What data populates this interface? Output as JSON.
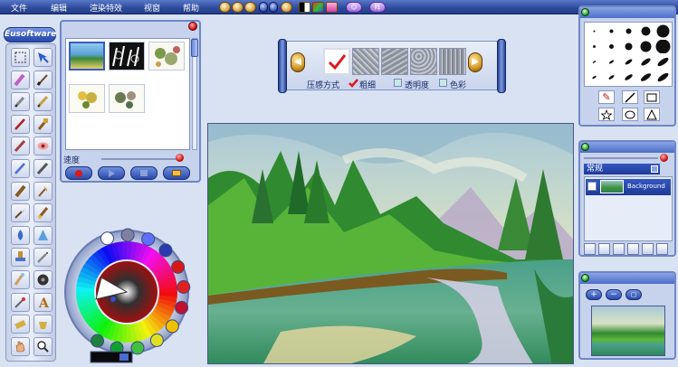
{
  "menu": {
    "items": [
      "文件",
      "编辑",
      "渲染特效",
      "视窗",
      "帮助"
    ],
    "pill_label": "阵"
  },
  "brand": {
    "name": "Eusoftware"
  },
  "tools": [
    {
      "name": "rect-select-tool",
      "icon": "dashed-rect-icon"
    },
    {
      "name": "move-tool",
      "icon": "move-arrow-icon"
    },
    {
      "name": "crayon-tool",
      "icon": "crayon-icon"
    },
    {
      "name": "brush-tool",
      "icon": "fine-brush-icon"
    },
    {
      "name": "pen-tool",
      "icon": "pen-icon"
    },
    {
      "name": "pencil-tool",
      "icon": "pencil-icon"
    },
    {
      "name": "oil-brush-tool",
      "icon": "oil-brush-icon"
    },
    {
      "name": "flat-brush-tool",
      "icon": "flat-brush-icon"
    },
    {
      "name": "marker-tool",
      "icon": "marker-icon"
    },
    {
      "name": "eye-tool",
      "icon": "eye-icon"
    },
    {
      "name": "airbrush-tool",
      "icon": "airbrush-icon"
    },
    {
      "name": "charcoal-tool",
      "icon": "charcoal-icon"
    },
    {
      "name": "wide-brush-tool",
      "icon": "wide-brush-icon"
    },
    {
      "name": "fan-brush-tool",
      "icon": "fan-brush-icon"
    },
    {
      "name": "palette-knife-tool",
      "icon": "palette-knife-icon"
    },
    {
      "name": "watercolor-tool",
      "icon": "watercolor-brush-icon"
    },
    {
      "name": "drop-tool",
      "icon": "drop-icon"
    },
    {
      "name": "cone-tool",
      "icon": "cone-icon"
    },
    {
      "name": "stamp-tool",
      "icon": "stamp-icon"
    },
    {
      "name": "spray-tool",
      "icon": "spray-icon"
    },
    {
      "name": "smudge-tool",
      "icon": "smudge-icon"
    },
    {
      "name": "blur-tool",
      "icon": "blur-circle-icon"
    },
    {
      "name": "eyedropper-tool",
      "icon": "eyedropper-icon"
    },
    {
      "name": "text-tool",
      "icon": "letter-a-icon"
    },
    {
      "name": "eraser-tool",
      "icon": "eraser-icon"
    },
    {
      "name": "bucket-tool",
      "icon": "bucket-icon"
    },
    {
      "name": "hand-tool",
      "icon": "hand-icon"
    },
    {
      "name": "zoom-tool",
      "icon": "magnifier-icon"
    }
  ],
  "brush_panel": {
    "speed_label": "速度",
    "speed_value": 0.95
  },
  "props": {
    "pressure_label": "压感方式",
    "thickness_label": "粗细",
    "thickness_checked": true,
    "opacity_label": "透明度",
    "opacity_checked": false,
    "color_label": "色彩",
    "color_checked": false
  },
  "layers": {
    "mode": "常规",
    "layer_name": "Background"
  },
  "colors": {
    "accent": "#2d4a9c",
    "panel": "#c7d3ec",
    "swatches": [
      "#ffffff",
      "#8080a0",
      "#6070ff",
      "#2a3ab0",
      "#d81818",
      "#e02020",
      "#c01030",
      "#f0c000",
      "#e0e020",
      "#40c040",
      "#10a030",
      "#208040"
    ]
  }
}
